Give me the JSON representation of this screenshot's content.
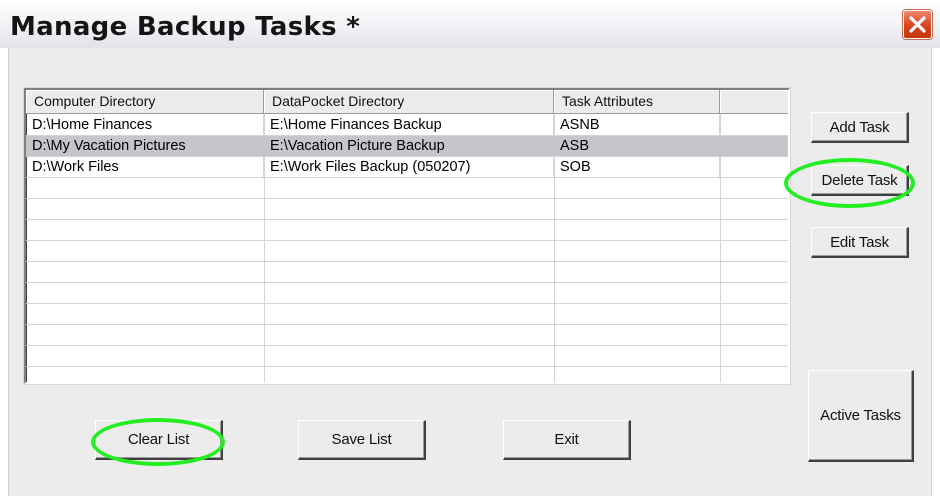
{
  "window": {
    "title": "Manage Backup Tasks *",
    "close_icon": "close-x-icon"
  },
  "table": {
    "columns": [
      "Computer Directory",
      "DataPocket Directory",
      "Task Attributes",
      ""
    ],
    "rows": [
      {
        "computer_dir": "D:\\Home Finances",
        "datapocket_dir": "E:\\Home Finances Backup",
        "attributes": "ASNB",
        "selected": false
      },
      {
        "computer_dir": "D:\\My Vacation Pictures",
        "datapocket_dir": "E:\\Vacation Picture Backup",
        "attributes": "ASB",
        "selected": true
      },
      {
        "computer_dir": "D:\\Work Files",
        "datapocket_dir": "E:\\Work Files Backup (050207)",
        "attributes": "SOB",
        "selected": false
      }
    ]
  },
  "buttons": {
    "add_task": "Add Task",
    "delete_task": "Delete Task",
    "edit_task": "Edit Task",
    "active_tasks": "Active Tasks",
    "clear_list": "Clear List",
    "save_list": "Save List",
    "exit": "Exit"
  },
  "colors": {
    "highlight_circle": "#22ee22",
    "selected_row": "#c5c5cc",
    "close_button": "#d6451e"
  }
}
